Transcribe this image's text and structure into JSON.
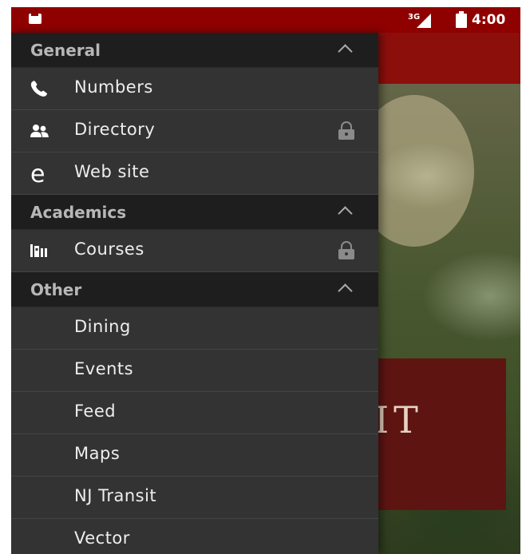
{
  "status_bar": {
    "network": "3G",
    "time": "4:00"
  },
  "background": {
    "sign_text": "IT"
  },
  "drawer": {
    "sections": [
      {
        "title": "General",
        "items": [
          {
            "label": "Numbers",
            "icon": "phone-icon",
            "locked": false
          },
          {
            "label": "Directory",
            "icon": "people-icon",
            "locked": true
          },
          {
            "label": "Web site",
            "icon": "web-e-icon",
            "locked": false
          }
        ]
      },
      {
        "title": "Academics",
        "items": [
          {
            "label": "Courses",
            "icon": "books-icon",
            "locked": true
          }
        ]
      },
      {
        "title": "Other",
        "items": [
          {
            "label": "Dining"
          },
          {
            "label": "Events"
          },
          {
            "label": "Feed"
          },
          {
            "label": "Maps"
          },
          {
            "label": "NJ Transit"
          },
          {
            "label": "Vector"
          }
        ]
      }
    ]
  },
  "colors": {
    "status_bar": "#8f0000",
    "drawer_bg": "#333333",
    "section_header_bg": "#1e1e1e",
    "app_header": "#8d0f0c"
  }
}
